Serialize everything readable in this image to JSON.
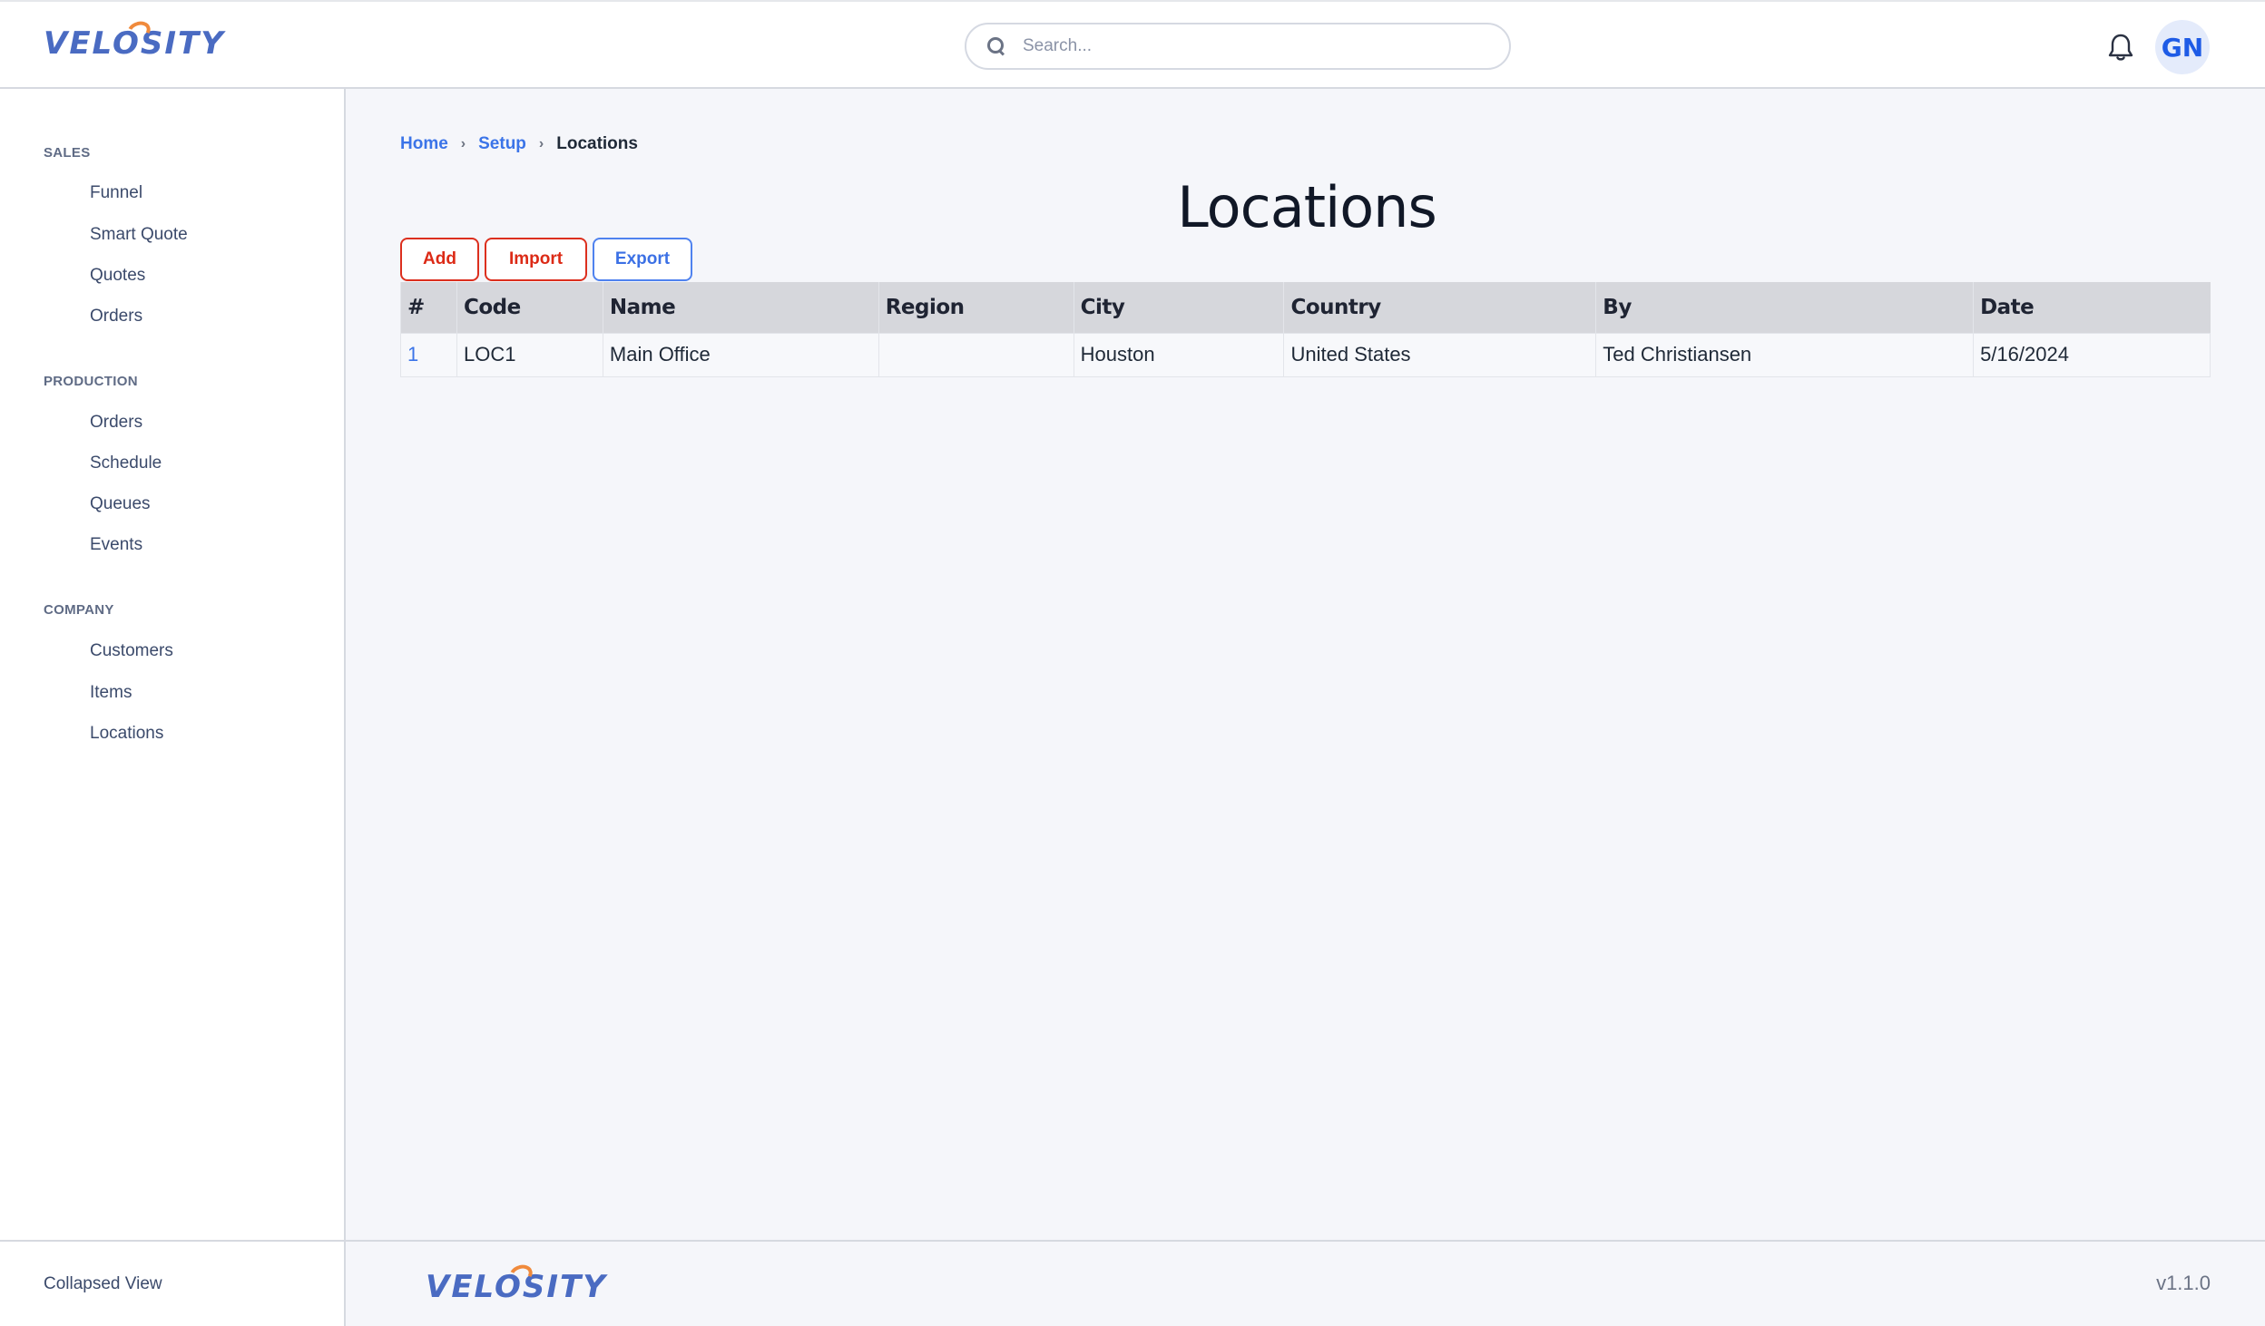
{
  "app": {
    "logo_text": "VELOSITY",
    "brand_colors": {
      "primary": "#4a6bc2",
      "accent": "#f08a3c"
    }
  },
  "header": {
    "search": {
      "placeholder": "Search...",
      "value": ""
    },
    "notifications_icon": "bell-icon",
    "avatar_initials": "GN"
  },
  "sidebar": {
    "sections": [
      {
        "title": "SALES",
        "items": [
          {
            "label": "Funnel"
          },
          {
            "label": "Smart Quote"
          },
          {
            "label": "Quotes"
          },
          {
            "label": "Orders"
          }
        ]
      },
      {
        "title": "PRODUCTION",
        "items": [
          {
            "label": "Orders"
          },
          {
            "label": "Schedule"
          },
          {
            "label": "Queues"
          },
          {
            "label": "Events"
          }
        ]
      },
      {
        "title": "COMPANY",
        "items": [
          {
            "label": "Customers"
          },
          {
            "label": "Items"
          },
          {
            "label": "Locations"
          }
        ]
      }
    ],
    "collapsed_view_label": "Collapsed View"
  },
  "breadcrumb": [
    {
      "label": "Home",
      "link": true
    },
    {
      "label": "Setup",
      "link": true
    },
    {
      "label": "Locations",
      "link": false
    }
  ],
  "main": {
    "title": "Locations",
    "buttons": {
      "add": "Add",
      "import": "Import",
      "export": "Export"
    },
    "table": {
      "columns": [
        "#",
        "Code",
        "Name",
        "Region",
        "City",
        "Country",
        "By",
        "Date"
      ],
      "rows": [
        [
          "1",
          "LOC1",
          "Main Office",
          "",
          "Houston",
          "United States",
          "Ted Christiansen",
          "5/16/2024"
        ]
      ]
    }
  },
  "footer": {
    "logo_text": "VELOSITY",
    "version": "v1.1.0"
  }
}
